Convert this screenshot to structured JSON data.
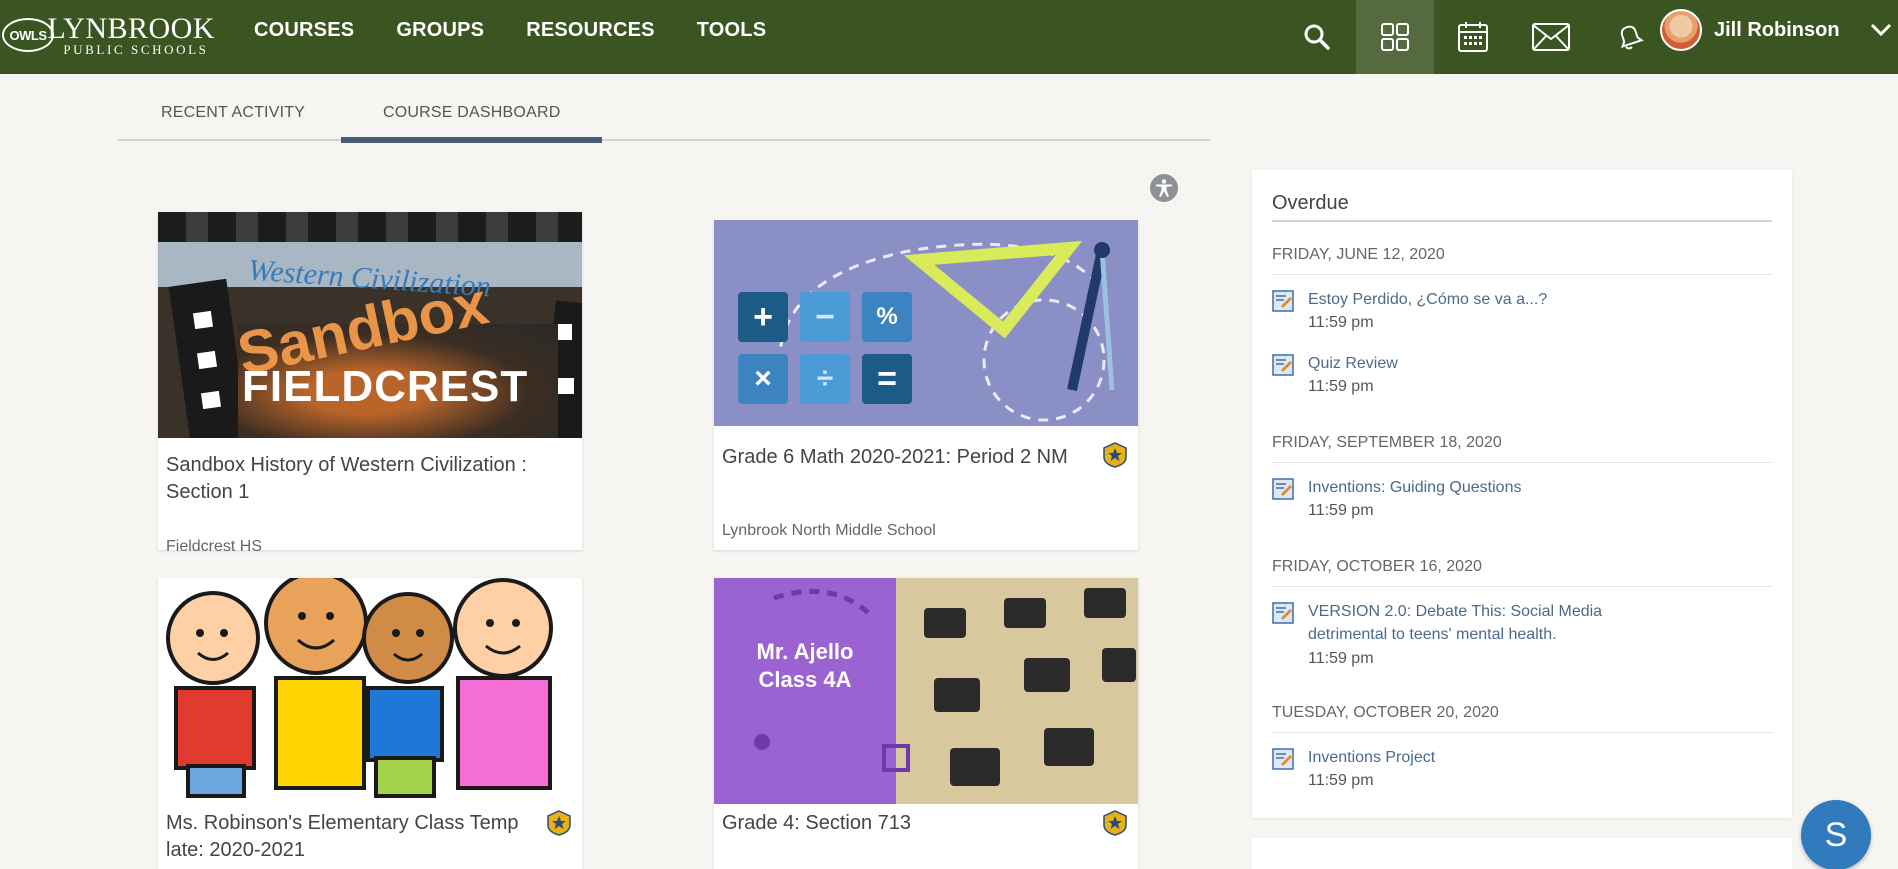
{
  "brand": {
    "badge": "OWLS",
    "name": "LYNBROOK",
    "subtitle": "PUBLIC SCHOOLS"
  },
  "nav": {
    "links": [
      "COURSES",
      "GROUPS",
      "RESOURCES",
      "TOOLS"
    ],
    "icons": [
      "search-icon",
      "grid-icon",
      "calendar-icon",
      "mail-icon",
      "bell-icon"
    ],
    "active_icon": "grid-icon",
    "user_name": "Jill Robinson"
  },
  "tabs": [
    "RECENT ACTIVITY",
    "COURSE DASHBOARD"
  ],
  "active_tab": "COURSE DASHBOARD",
  "courses": [
    {
      "title": "Sandbox History of Western Civilization : Section 1",
      "school": "Fieldcrest HS",
      "thumb_text": [
        "Western Civilization",
        "Sandbox",
        "FIELDCREST"
      ],
      "starred": false
    },
    {
      "title": "Grade 6 Math 2020-2021: Period 2 NM",
      "school": "Lynbrook North Middle School",
      "thumb_text": [
        "+",
        "−",
        "%",
        "×",
        "÷",
        "="
      ],
      "starred": true
    },
    {
      "title": "Ms. Robinson's Elementary Class Temp late: 2020-2021",
      "school": "",
      "starred": true
    },
    {
      "title": "Grade 4: Section 713",
      "school": "",
      "thumb_text": [
        "Mr. Ajello",
        "Class 4A"
      ],
      "starred": true
    }
  ],
  "overdue": {
    "title": "Overdue",
    "groups": [
      {
        "date": "FRIDAY, JUNE 12, 2020",
        "items": [
          {
            "name": "Estoy Perdido, ¿Cómo se va a...?",
            "time": "11:59 pm"
          },
          {
            "name": "Quiz Review",
            "time": "11:59 pm"
          }
        ]
      },
      {
        "date": "FRIDAY, SEPTEMBER 18, 2020",
        "items": [
          {
            "name": "Inventions: Guiding Questions",
            "time": "11:59 pm"
          }
        ]
      },
      {
        "date": "FRIDAY, OCTOBER 16, 2020",
        "items": [
          {
            "name": "VERSION 2.0: Debate This: Social Media detrimental to teens' mental health.",
            "time": "11:59 pm"
          }
        ]
      },
      {
        "date": "TUESDAY, OCTOBER 20, 2020",
        "items": [
          {
            "name": "Inventions Project",
            "time": "11:59 pm"
          }
        ]
      }
    ]
  },
  "help_button": "S",
  "colors": {
    "topbar": "#3a5521",
    "link": "#4a6a8c",
    "tab_underline": "#4c5c74",
    "help": "#2f7bbd"
  }
}
